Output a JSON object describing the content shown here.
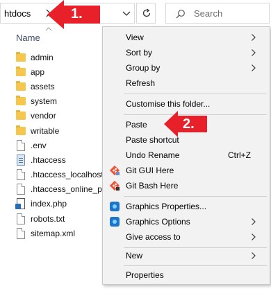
{
  "address_bar": {
    "path": "htdocs"
  },
  "search": {
    "placeholder": "Search"
  },
  "file_list": {
    "column_header": "Name",
    "items": [
      {
        "name": "admin",
        "type": "folder"
      },
      {
        "name": "app",
        "type": "folder"
      },
      {
        "name": "assets",
        "type": "folder"
      },
      {
        "name": "system",
        "type": "folder"
      },
      {
        "name": "vendor",
        "type": "folder"
      },
      {
        "name": "writable",
        "type": "folder"
      },
      {
        "name": ".env",
        "type": "file"
      },
      {
        "name": ".htaccess",
        "type": "htaccess"
      },
      {
        "name": ".htaccess_localhost",
        "type": "file"
      },
      {
        "name": ".htaccess_online_ph",
        "type": "file"
      },
      {
        "name": "index.php",
        "type": "php"
      },
      {
        "name": "robots.txt",
        "type": "file"
      },
      {
        "name": "sitemap.xml",
        "type": "file"
      }
    ]
  },
  "context_menu": {
    "items": {
      "view": {
        "label": "View"
      },
      "sort_by": {
        "label": "Sort by"
      },
      "group_by": {
        "label": "Group by"
      },
      "refresh": {
        "label": "Refresh"
      },
      "customise": {
        "label": "Customise this folder..."
      },
      "paste": {
        "label": "Paste"
      },
      "paste_shortcut": {
        "label": "Paste shortcut"
      },
      "undo_rename": {
        "label": "Undo Rename",
        "shortcut": "Ctrl+Z"
      },
      "git_gui": {
        "label": "Git GUI Here"
      },
      "git_bash": {
        "label": "Git Bash Here"
      },
      "graphics_properties": {
        "label": "Graphics Properties..."
      },
      "graphics_options": {
        "label": "Graphics Options"
      },
      "give_access": {
        "label": "Give access to"
      },
      "new": {
        "label": "New"
      },
      "properties": {
        "label": "Properties"
      }
    }
  },
  "annotations": {
    "step1": "1.",
    "step2": "2."
  },
  "colors": {
    "callout": "#e8202a",
    "menu_bg": "#f2f2f2",
    "folder": "#f5c74c"
  },
  "icons": {
    "breadcrumb": "chevron-right-icon",
    "dropdown": "chevron-down-icon",
    "refresh": "refresh-icon",
    "search": "search-icon",
    "submenu": "chevron-right-icon"
  }
}
